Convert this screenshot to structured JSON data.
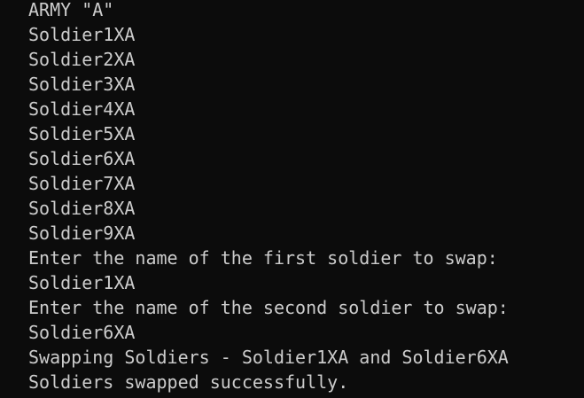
{
  "terminal": {
    "lines": [
      "ARMY \"A\"",
      "Soldier1XA",
      "Soldier2XA",
      "Soldier3XA",
      "Soldier4XA",
      "Soldier5XA",
      "Soldier6XA",
      "Soldier7XA",
      "Soldier8XA",
      "Soldier9XA",
      "Enter the name of the first soldier to swap:",
      "Soldier1XA",
      "Enter the name of the second soldier to swap:",
      "Soldier6XA",
      "Swapping Soldiers - Soldier1XA and Soldier6XA",
      "Soldiers swapped successfully."
    ]
  },
  "colors": {
    "background": "#0c0c0c",
    "foreground": "#cccccc"
  }
}
